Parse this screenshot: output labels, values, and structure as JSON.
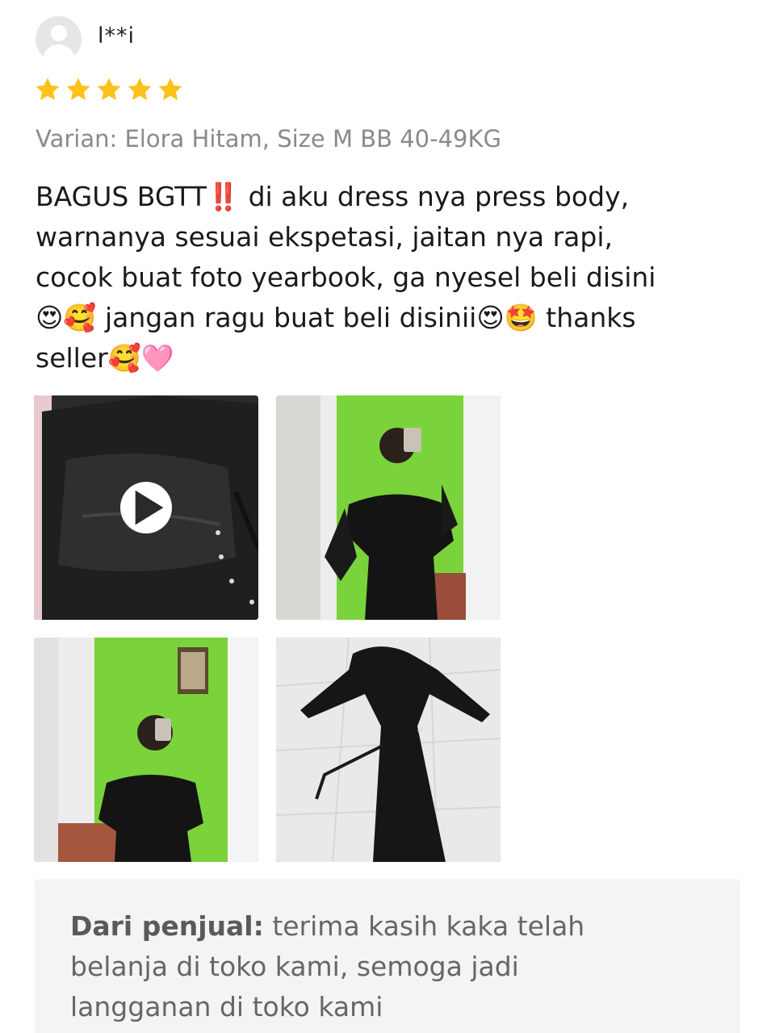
{
  "reviewer": {
    "name": "l**i",
    "avatar_icon": "default-user-icon"
  },
  "rating": {
    "value": 5,
    "max": 5,
    "star_color": "#fcc11b"
  },
  "variant_text": "Varian: Elora Hitam, Size M BB 40-49KG",
  "review_text": "BAGUS BGTT‼️ di aku dress nya press body,\nwarnanya sesuai ekspetasi, jaitan nya rapi,\ncocok buat foto yearbook, ga nyesel beli disini\n😍🥰 jangan ragu buat beli disinii😍🤩 thanks\nseller🥰🩷",
  "media": [
    {
      "type": "video",
      "icon": "play-icon"
    },
    {
      "type": "photo"
    },
    {
      "type": "photo"
    },
    {
      "type": "photo"
    }
  ],
  "seller_reply": {
    "label": "Dari penjual:",
    "text": " terima kasih kaka telah\nbelanja di toko kami, semoga jadi\nlangganan di toko kami"
  }
}
